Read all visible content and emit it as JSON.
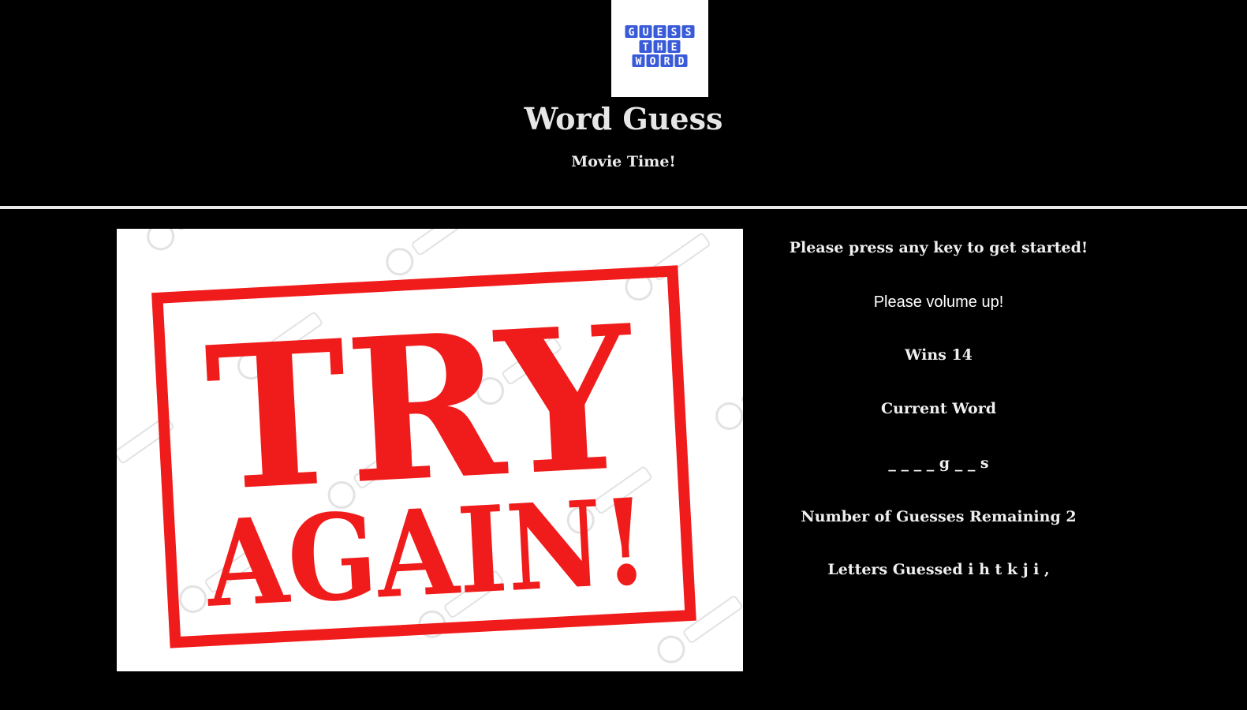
{
  "header": {
    "logo": {
      "icon": "guess-the-word-logo",
      "lines": [
        "GUESS",
        "THE",
        "WORD"
      ],
      "tile_color": "#3a5bd8"
    },
    "title": "Word Guess",
    "subtitle": "Movie Time!"
  },
  "result_image": {
    "stamp_line1": "TRY",
    "stamp_line2": "AGAIN!",
    "stamp_color": "#f01b1b"
  },
  "info": {
    "prompt": "Please press any key to get started!",
    "volume_note": "Please volume up!",
    "wins_text": "Wins 14",
    "current_word_label": "Current Word",
    "current_word_value": "_ _ _ _ g _ _ s",
    "guesses_remaining_text": "Number of Guesses Remaining 2",
    "letters_guessed_text": "Letters Guessed i h t k j i ,"
  },
  "colors": {
    "background": "#000000",
    "text": "#e8e8e8",
    "divider": "#e9e9e9"
  }
}
